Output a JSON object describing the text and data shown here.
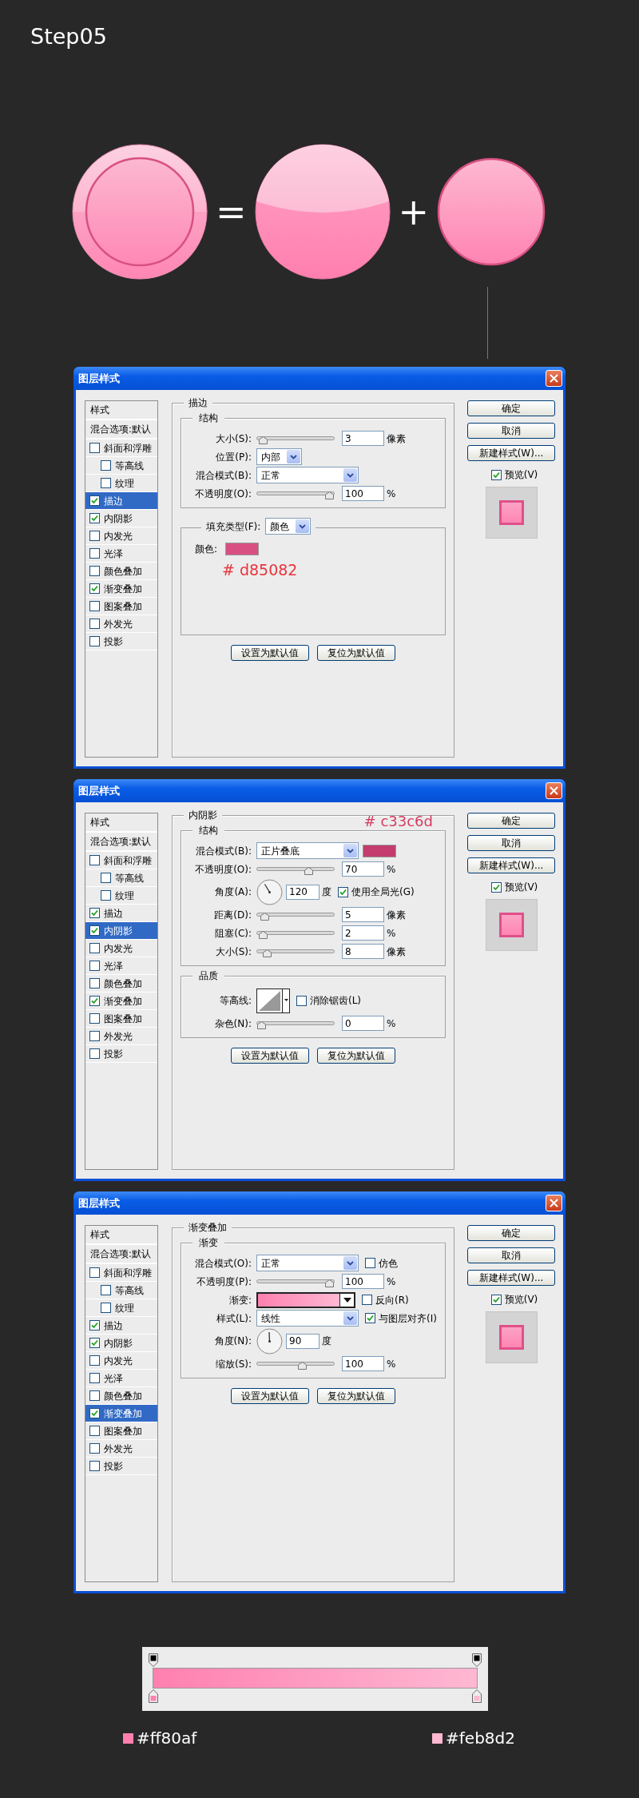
{
  "heading": "Step05",
  "equation": {
    "operators": [
      "=",
      "+"
    ]
  },
  "dialogs": [
    {
      "title": "图层样式",
      "list_headers": [
        "样式",
        "混合选项:默认"
      ],
      "effects": [
        {
          "label": "斜面和浮雕",
          "kind": "item",
          "checked": false,
          "selected": false
        },
        {
          "label": "等高线",
          "kind": "subitem",
          "checked": false,
          "selected": false
        },
        {
          "label": "纹理",
          "kind": "subitem",
          "checked": false,
          "selected": false
        },
        {
          "label": "描边",
          "kind": "item",
          "checked": true,
          "selected": true
        },
        {
          "label": "内阴影",
          "kind": "item",
          "checked": true,
          "selected": false
        },
        {
          "label": "内发光",
          "kind": "item",
          "checked": false,
          "selected": false
        },
        {
          "label": "光泽",
          "kind": "item",
          "checked": false,
          "selected": false
        },
        {
          "label": "颜色叠加",
          "kind": "item",
          "checked": false,
          "selected": false
        },
        {
          "label": "渐变叠加",
          "kind": "item",
          "checked": true,
          "selected": false
        },
        {
          "label": "图案叠加",
          "kind": "item",
          "checked": false,
          "selected": false
        },
        {
          "label": "外发光",
          "kind": "item",
          "checked": false,
          "selected": false
        },
        {
          "label": "投影",
          "kind": "item",
          "checked": false,
          "selected": false
        }
      ],
      "group_title": "描边",
      "sections": [
        {
          "title": "结构",
          "rows": [
            {
              "kind": "slider",
              "label": "大小(S):",
              "level": 0.02,
              "value": "3",
              "unit": "像素"
            },
            {
              "kind": "compact_select",
              "label": "位置(P):",
              "value": "内部"
            },
            {
              "kind": "select",
              "label": "混合模式(B):",
              "value": "正常"
            },
            {
              "kind": "slider",
              "label": "不透明度(O):",
              "level": 1,
              "value": "100",
              "unit": "%"
            }
          ]
        },
        {
          "title_select": {
            "label": "填充类型(F):",
            "value": "颜色"
          },
          "rows": [
            {
              "kind": "color",
              "label": "颜色:",
              "color": "#d85082"
            }
          ],
          "annotation": "# d85082"
        }
      ],
      "section_buttons": [
        "设置为默认值",
        "复位为默认值"
      ],
      "buttons": [
        "确定",
        "取消",
        "新建样式(W)..."
      ],
      "preview": {
        "label": "预览(V)",
        "checked": true
      }
    },
    {
      "title": "图层样式",
      "list_headers": [
        "样式",
        "混合选项:默认"
      ],
      "effects": [
        {
          "label": "斜面和浮雕",
          "kind": "item",
          "checked": false,
          "selected": false
        },
        {
          "label": "等高线",
          "kind": "subitem",
          "checked": false,
          "selected": false
        },
        {
          "label": "纹理",
          "kind": "subitem",
          "checked": false,
          "selected": false
        },
        {
          "label": "描边",
          "kind": "item",
          "checked": true,
          "selected": false
        },
        {
          "label": "内阴影",
          "kind": "item",
          "checked": true,
          "selected": true
        },
        {
          "label": "内发光",
          "kind": "item",
          "checked": false,
          "selected": false
        },
        {
          "label": "光泽",
          "kind": "item",
          "checked": false,
          "selected": false
        },
        {
          "label": "颜色叠加",
          "kind": "item",
          "checked": false,
          "selected": false
        },
        {
          "label": "渐变叠加",
          "kind": "item",
          "checked": true,
          "selected": false
        },
        {
          "label": "图案叠加",
          "kind": "item",
          "checked": false,
          "selected": false
        },
        {
          "label": "外发光",
          "kind": "item",
          "checked": false,
          "selected": false
        },
        {
          "label": "投影",
          "kind": "item",
          "checked": false,
          "selected": false
        }
      ],
      "group_title": "内阴影",
      "annotation": "# c33c6d",
      "sections": [
        {
          "title": "结构",
          "rows": [
            {
              "kind": "select",
              "label": "混合模式(B):",
              "value": "正片叠底",
              "color": "#c33c6d"
            },
            {
              "kind": "slider",
              "label": "不透明度(O):",
              "level": 0.7,
              "value": "70",
              "unit": "%"
            },
            {
              "kind": "angle",
              "label": "角度(A):",
              "value": "120",
              "unit": "度",
              "checkbox": {
                "label": "使用全局光(G)",
                "checked": true
              }
            },
            {
              "kind": "slider",
              "label": "距离(D):",
              "level": 0.05,
              "value": "5",
              "unit": "像素"
            },
            {
              "kind": "slider",
              "label": "阻塞(C):",
              "level": 0.02,
              "value": "2",
              "unit": "%"
            },
            {
              "kind": "slider",
              "label": "大小(S):",
              "level": 0.08,
              "value": "8",
              "unit": "像素"
            }
          ]
        },
        {
          "title": "品质",
          "rows": [
            {
              "kind": "contour",
              "label": "等高线:",
              "checkbox": {
                "label": "消除锯齿(L)",
                "checked": false
              }
            },
            {
              "kind": "slider",
              "label": "杂色(N):",
              "level": 0,
              "value": "0",
              "unit": "%"
            }
          ]
        }
      ],
      "section_buttons": [
        "设置为默认值",
        "复位为默认值"
      ],
      "buttons": [
        "确定",
        "取消",
        "新建样式(W)..."
      ],
      "preview": {
        "label": "预览(V)",
        "checked": true
      }
    },
    {
      "title": "图层样式",
      "list_headers": [
        "样式",
        "混合选项:默认"
      ],
      "effects": [
        {
          "label": "斜面和浮雕",
          "kind": "item",
          "checked": false,
          "selected": false
        },
        {
          "label": "等高线",
          "kind": "subitem",
          "checked": false,
          "selected": false
        },
        {
          "label": "纹理",
          "kind": "subitem",
          "checked": false,
          "selected": false
        },
        {
          "label": "描边",
          "kind": "item",
          "checked": true,
          "selected": false
        },
        {
          "label": "内阴影",
          "kind": "item",
          "checked": true,
          "selected": false
        },
        {
          "label": "内发光",
          "kind": "item",
          "checked": false,
          "selected": false
        },
        {
          "label": "光泽",
          "kind": "item",
          "checked": false,
          "selected": false
        },
        {
          "label": "颜色叠加",
          "kind": "item",
          "checked": false,
          "selected": false
        },
        {
          "label": "渐变叠加",
          "kind": "item",
          "checked": true,
          "selected": true
        },
        {
          "label": "图案叠加",
          "kind": "item",
          "checked": false,
          "selected": false
        },
        {
          "label": "外发光",
          "kind": "item",
          "checked": false,
          "selected": false
        },
        {
          "label": "投影",
          "kind": "item",
          "checked": false,
          "selected": false
        }
      ],
      "group_title": "渐变叠加",
      "sections": [
        {
          "title": "渐变",
          "rows": [
            {
              "kind": "select",
              "label": "混合模式(O):",
              "value": "正常",
              "checkbox": {
                "label": "仿色",
                "checked": false
              }
            },
            {
              "kind": "slider",
              "label": "不透明度(P):",
              "level": 1,
              "value": "100",
              "unit": "%"
            },
            {
              "kind": "gradient",
              "label": "渐变:",
              "checkbox": {
                "label": "反向(R)",
                "checked": false
              }
            },
            {
              "kind": "select",
              "label": "样式(L):",
              "value": "线性",
              "checkbox": {
                "label": "与图层对齐(I)",
                "checked": true
              }
            },
            {
              "kind": "angle",
              "label": "角度(N):",
              "value": "90",
              "unit": "度"
            },
            {
              "kind": "slider",
              "label": "缩放(S):",
              "level": 0.6,
              "value": "100",
              "unit": "%"
            }
          ]
        }
      ],
      "section_buttons": [
        "设置为默认值",
        "复位为默认值"
      ],
      "buttons": [
        "确定",
        "取消",
        "新建样式(W)..."
      ],
      "preview": {
        "label": "预览(V)",
        "checked": true
      }
    }
  ],
  "gradient_editor": {
    "stops": [
      {
        "label": "#ff80af",
        "color": "#ff80af"
      },
      {
        "label": "#feb8d2",
        "color": "#feb8d2"
      }
    ]
  }
}
